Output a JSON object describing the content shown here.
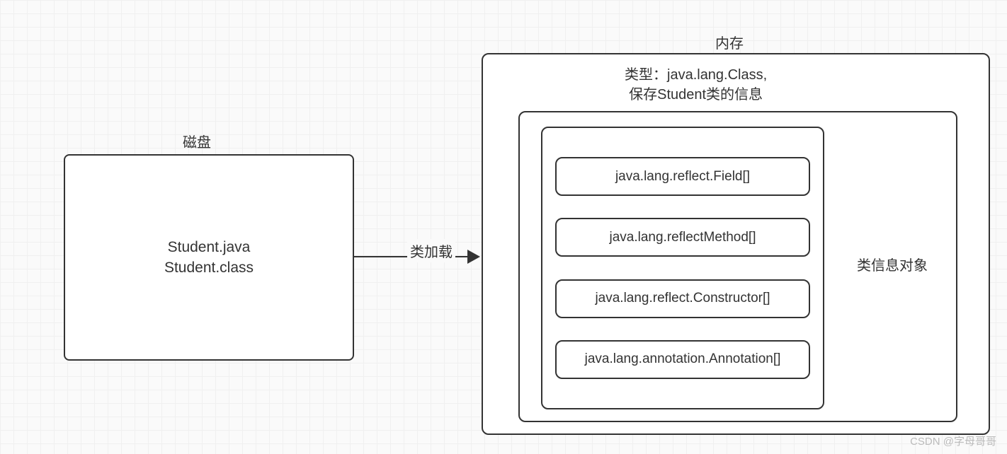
{
  "disk": {
    "label": "磁盘",
    "file1": "Student.java",
    "file2": "Student.class"
  },
  "arrow": {
    "label": "类加载"
  },
  "memory": {
    "label": "内存",
    "class_info_line1": "类型：java.lang.Class,",
    "class_info_line2": "保存Student类的信息",
    "side_label": "类信息对象",
    "reflect_items": {
      "field": "java.lang.reflect.Field[]",
      "method": "java.lang.reflectMethod[]",
      "constructor": "java.lang.reflect.Constructor[]",
      "annotation": "java.lang.annotation.Annotation[]"
    }
  },
  "watermark": "CSDN @字母哥哥"
}
